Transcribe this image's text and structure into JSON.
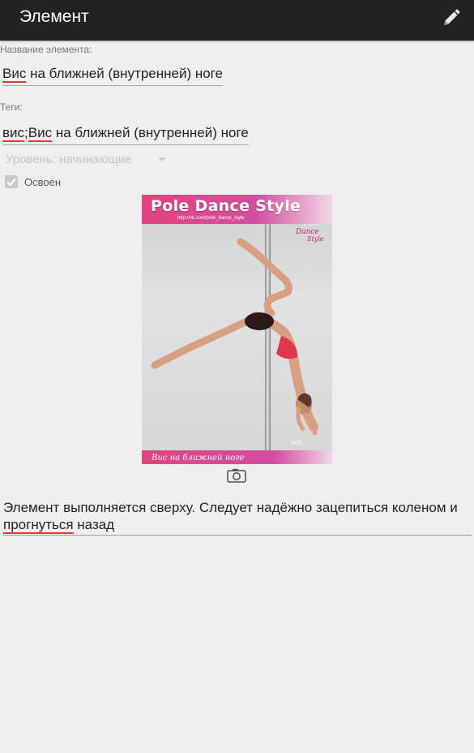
{
  "action_bar": {
    "title": "Элемент",
    "edit_icon": "pencil-icon"
  },
  "name_label": "Название элемента:",
  "name_value": {
    "w1": "Вис",
    "rest": " на ближней (внутренней) ноге"
  },
  "tags_label": "Теги:",
  "tags_value": {
    "w1": "вис",
    "sep": ";",
    "w2": "Вис",
    "rest": " на ближней (внутренней) ноге"
  },
  "level": {
    "text": "Уровень: начинающие"
  },
  "mastered": {
    "label": "Освоен",
    "checked": true
  },
  "poster": {
    "title": "Pole Dance Style",
    "url": "http://vk.com/pole_dance_style",
    "caption": "Вис на ближней ноге"
  },
  "camera_icon": "camera-icon",
  "description": {
    "p1": "Элемент выполняется сверху. Следует надёжно зацепиться коленом и ",
    "sp": "прогнуться",
    "p2": " назад"
  },
  "colors": {
    "action_bar": "#222222",
    "background": "#efefef",
    "spell_underline": "#e53935",
    "poster_pink": "#e0437f"
  }
}
